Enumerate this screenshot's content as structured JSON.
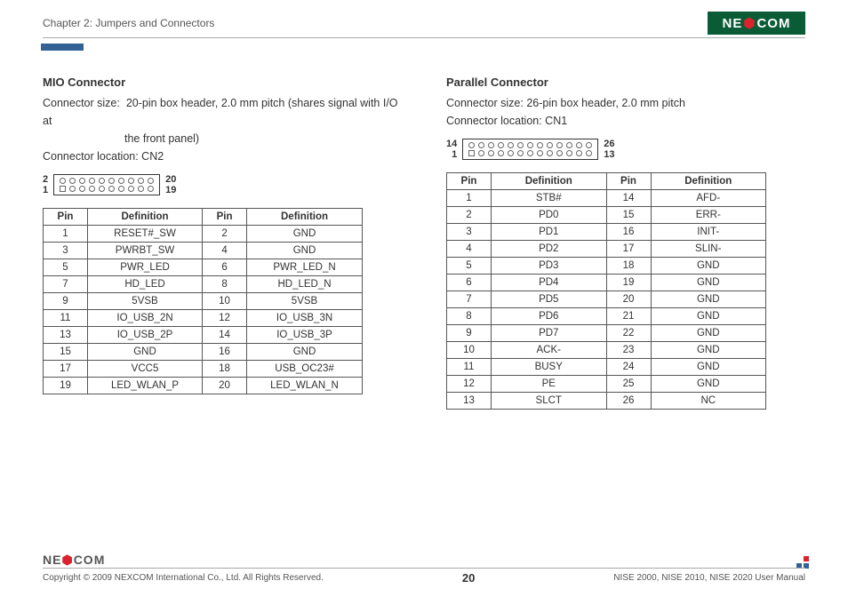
{
  "header": {
    "chapter": "Chapter 2: Jumpers and Connectors",
    "logo_text": "NE COM"
  },
  "left": {
    "title": "MIO Connector",
    "size_label": "Connector size:",
    "size_value": "20-pin box header, 2.0 mm pitch (shares signal with I/O at",
    "size_value2": "the front panel)",
    "location": "Connector location: CN2",
    "diag_tl": "2",
    "diag_bl": "1",
    "diag_tr": "20",
    "diag_br": "19",
    "th_pin": "Pin",
    "th_def": "Definition",
    "rows": [
      {
        "p1": "1",
        "d1": "RESET#_SW",
        "p2": "2",
        "d2": "GND"
      },
      {
        "p1": "3",
        "d1": "PWRBT_SW",
        "p2": "4",
        "d2": "GND"
      },
      {
        "p1": "5",
        "d1": "PWR_LED",
        "p2": "6",
        "d2": "PWR_LED_N"
      },
      {
        "p1": "7",
        "d1": "HD_LED",
        "p2": "8",
        "d2": "HD_LED_N"
      },
      {
        "p1": "9",
        "d1": "5VSB",
        "p2": "10",
        "d2": "5VSB"
      },
      {
        "p1": "11",
        "d1": "IO_USB_2N",
        "p2": "12",
        "d2": "IO_USB_3N"
      },
      {
        "p1": "13",
        "d1": "IO_USB_2P",
        "p2": "14",
        "d2": "IO_USB_3P"
      },
      {
        "p1": "15",
        "d1": "GND",
        "p2": "16",
        "d2": "GND"
      },
      {
        "p1": "17",
        "d1": "VCC5",
        "p2": "18",
        "d2": "USB_OC23#"
      },
      {
        "p1": "19",
        "d1": "LED_WLAN_P",
        "p2": "20",
        "d2": "LED_WLAN_N"
      }
    ]
  },
  "right": {
    "title": "Parallel Connector",
    "size": "Connector size:  26-pin box header, 2.0 mm pitch",
    "location": "Connector location: CN1",
    "diag_tl": "14",
    "diag_bl": "1",
    "diag_tr": "26",
    "diag_br": "13",
    "th_pin": "Pin",
    "th_def": "Definition",
    "rows": [
      {
        "p1": "1",
        "d1": "STB#",
        "p2": "14",
        "d2": "AFD-"
      },
      {
        "p1": "2",
        "d1": "PD0",
        "p2": "15",
        "d2": "ERR-"
      },
      {
        "p1": "3",
        "d1": "PD1",
        "p2": "16",
        "d2": "INIT-"
      },
      {
        "p1": "4",
        "d1": "PD2",
        "p2": "17",
        "d2": "SLIN-"
      },
      {
        "p1": "5",
        "d1": "PD3",
        "p2": "18",
        "d2": "GND"
      },
      {
        "p1": "6",
        "d1": "PD4",
        "p2": "19",
        "d2": "GND"
      },
      {
        "p1": "7",
        "d1": "PD5",
        "p2": "20",
        "d2": "GND"
      },
      {
        "p1": "8",
        "d1": "PD6",
        "p2": "21",
        "d2": "GND"
      },
      {
        "p1": "9",
        "d1": "PD7",
        "p2": "22",
        "d2": "GND"
      },
      {
        "p1": "10",
        "d1": "ACK-",
        "p2": "23",
        "d2": "GND"
      },
      {
        "p1": "11",
        "d1": "BUSY",
        "p2": "24",
        "d2": "GND"
      },
      {
        "p1": "12",
        "d1": "PE",
        "p2": "25",
        "d2": "GND"
      },
      {
        "p1": "13",
        "d1": "SLCT",
        "p2": "26",
        "d2": "NC"
      }
    ]
  },
  "footer": {
    "copyright": "Copyright © 2009 NEXCOM International Co., Ltd. All Rights Reserved.",
    "page": "20",
    "manual": "NISE 2000, NISE 2010, NISE 2020 User Manual"
  }
}
